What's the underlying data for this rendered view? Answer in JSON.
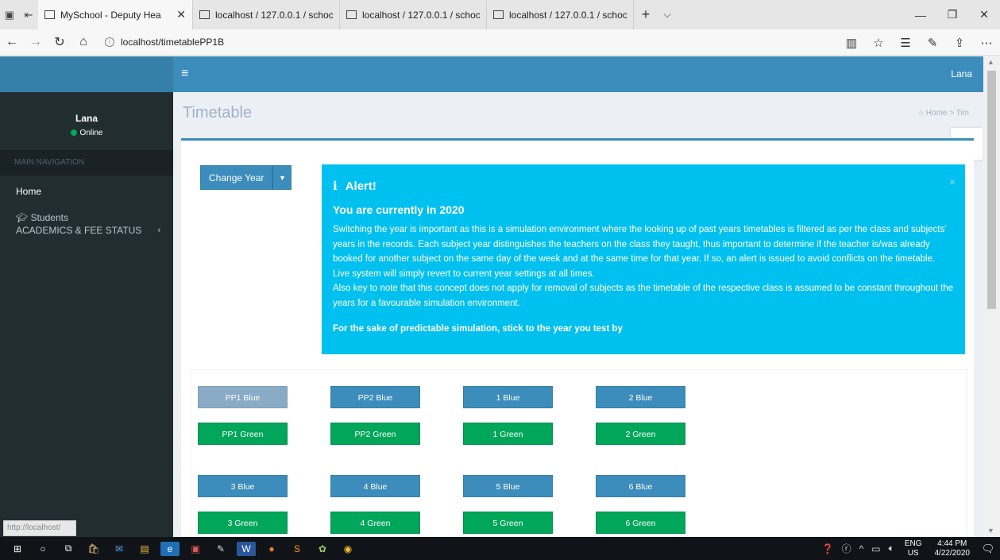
{
  "browser": {
    "tabs": [
      {
        "title": "MySchool - Deputy Hea",
        "active": true
      },
      {
        "title": "localhost / 127.0.0.1 / schoc",
        "active": false
      },
      {
        "title": "localhost / 127.0.0.1 / schoc",
        "active": false
      },
      {
        "title": "localhost / 127.0.0.1 / schoc",
        "active": false
      }
    ],
    "url": "localhost/timetablePP1B",
    "status_tip": "http://localhost/"
  },
  "header": {
    "user": "Lana"
  },
  "sidebar": {
    "user_name": "Lana",
    "status": "Online",
    "section_header": "MAIN NAVIGATION",
    "items": [
      {
        "label": "Home"
      },
      {
        "label": "Students",
        "sub": "ACADEMICS & FEE STATUS"
      }
    ]
  },
  "page": {
    "title": "Timetable",
    "breadcrumb_home": "Home",
    "breadcrumb_sep": ">",
    "breadcrumb_current": "Tim"
  },
  "change_year": {
    "label": "Change Year"
  },
  "alert": {
    "heading": "Alert!",
    "year_line": "You are currently in 2020",
    "body": "Switching the year is important as this is a simulation environment where the looking up of past years timetables is filtered as per the class and subjects' years in the records. Each subject year distinguishes the teachers on the class they taught, thus important to determine if the teacher is/was already booked for another subject on the same day of the week and at the same time for that year. If so, an alert is issued to avoid conflicts on the timetable. Live system will simply revert to current year settings at all times.",
    "body2": "Also key to note that this concept does not apply for removal of subjects as the timetable of the respective class is assumed to be constant throughout the years for a favourable simulation environment.",
    "footer": "For the sake of predictable simulation, stick to the year you test by",
    "close": "×"
  },
  "classes": [
    {
      "label": "PP1 Blue",
      "color": "blue",
      "faded": true
    },
    {
      "label": "PP2 Blue",
      "color": "blue"
    },
    {
      "label": "1 Blue",
      "color": "blue"
    },
    {
      "label": "2 Blue",
      "color": "blue"
    },
    {
      "label": "PP1 Green",
      "color": "green"
    },
    {
      "label": "PP2 Green",
      "color": "green"
    },
    {
      "label": "1 Green",
      "color": "green"
    },
    {
      "label": "2 Green",
      "color": "green"
    },
    {
      "label": "3 Blue",
      "color": "blue"
    },
    {
      "label": "4 Blue",
      "color": "blue"
    },
    {
      "label": "5 Blue",
      "color": "blue"
    },
    {
      "label": "6 Blue",
      "color": "blue"
    },
    {
      "label": "3 Green",
      "color": "green"
    },
    {
      "label": "4 Green",
      "color": "green"
    },
    {
      "label": "5 Green",
      "color": "green"
    },
    {
      "label": "6 Green",
      "color": "green"
    }
  ],
  "taskbar": {
    "lang_top": "ENG",
    "lang_bottom": "US",
    "time": "4:44 PM",
    "date": "4/22/2020"
  },
  "colors": {
    "primary": "#3c8dbc",
    "success": "#00a65a",
    "info": "#00c0ef",
    "sidebar": "#222d32"
  }
}
